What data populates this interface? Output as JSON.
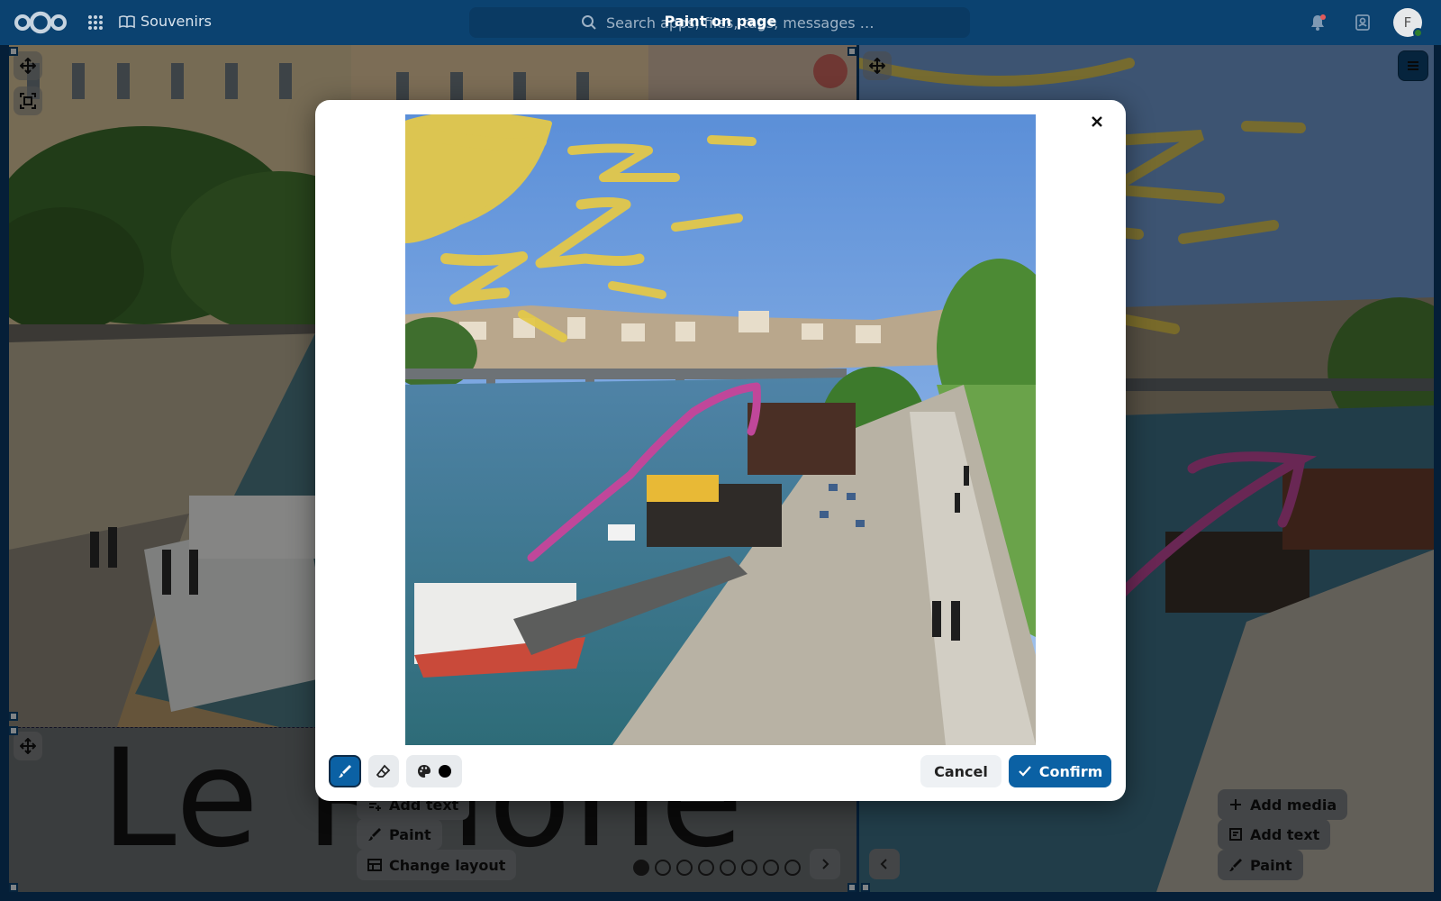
{
  "topbar": {
    "app_name": "Souvenirs",
    "search_placeholder": "Search apps, files, tags, messages …",
    "modal_heading": "Paint on page",
    "avatar_initial": "F"
  },
  "page": {
    "title_text": "Le Rhône",
    "left_actions": {
      "add_text": "Add text",
      "paint": "Paint",
      "change_layout": "Change layout"
    },
    "right_actions": {
      "add_media": "Add media",
      "add_text": "Add text",
      "paint": "Paint"
    },
    "pagination": {
      "total": 8,
      "current": 1
    }
  },
  "modal": {
    "cancel_label": "Cancel",
    "confirm_label": "Confirm",
    "brush_color": "#000000",
    "active_tool": "brush"
  },
  "colors": {
    "header": "#0b4270",
    "primary": "#0b61a4",
    "stroke_yellow": "#e3c84a",
    "stroke_magenta": "#c0479a"
  }
}
